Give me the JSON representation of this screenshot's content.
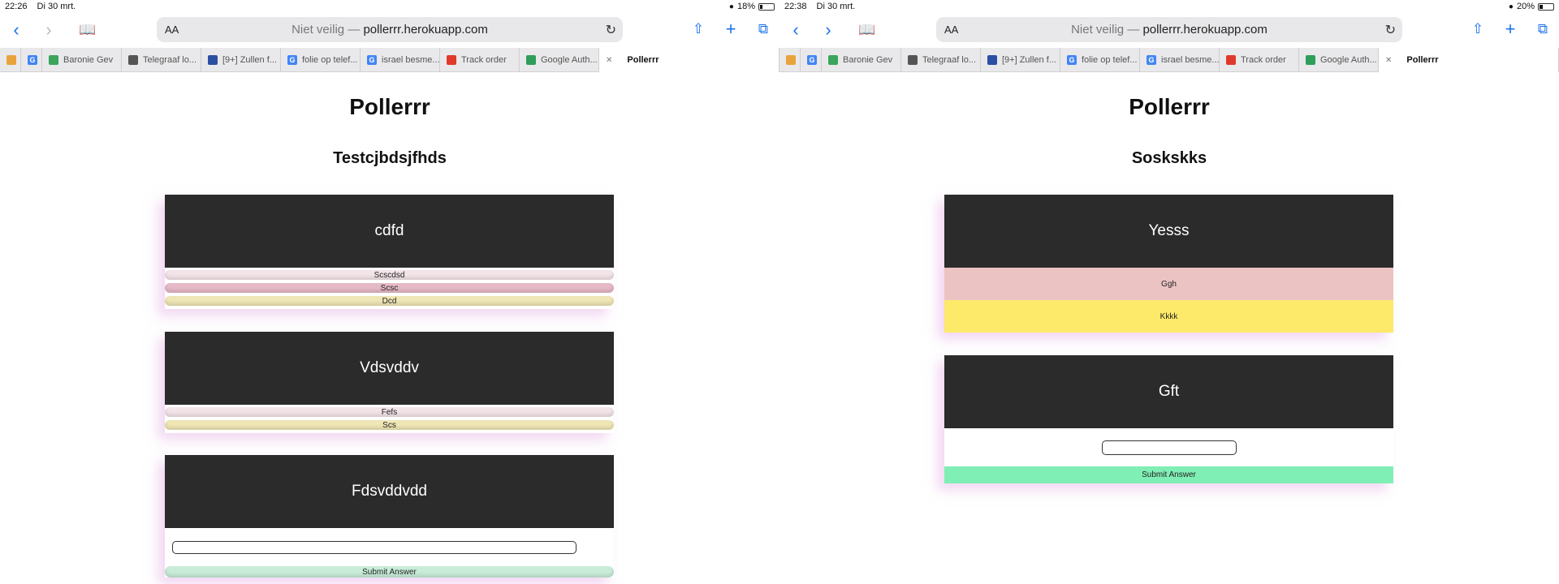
{
  "left": {
    "status": {
      "time": "22:26",
      "date": "Di 30 mrt.",
      "battery": "18%",
      "battery_level": 0.18
    },
    "url": {
      "aa": "AA",
      "insecure": "Niet veilig —",
      "host": "pollerrr.herokuapp.com"
    },
    "tabs": [
      {
        "label": "",
        "fav": "",
        "color": "#e8a33d"
      },
      {
        "label": "",
        "fav": "G",
        "color": "#4285f4"
      },
      {
        "label": "Baronie Gev",
        "fav": "",
        "color": "#3aa55b"
      },
      {
        "label": "Telegraaf lo...",
        "fav": "",
        "color": "#555555"
      },
      {
        "label": "[9+] Zullen f...",
        "fav": "",
        "color": "#2b4fa3"
      },
      {
        "label": "folie op telef...",
        "fav": "G",
        "color": "#4285f4"
      },
      {
        "label": "israel besme...",
        "fav": "G",
        "color": "#4285f4"
      },
      {
        "label": "Track order",
        "fav": "",
        "color": "#e0392b"
      },
      {
        "label": "Google Auth...",
        "fav": "",
        "color": "#2e9e5b"
      },
      {
        "label": "Pollerrr",
        "fav": "",
        "color": "#888888"
      }
    ],
    "site_title": "Pollerrr",
    "poll_title": "Testcjbdsjfhds",
    "questions": [
      {
        "title": "cdfd",
        "options": [
          {
            "label": "Scscdsd",
            "color": "#f3e4e8"
          },
          {
            "label": "Scsc",
            "color": "#e6b9c6"
          },
          {
            "label": "Dcd",
            "color": "#efe6b5"
          }
        ]
      },
      {
        "title": "Vdsvddv",
        "options": [
          {
            "label": "Fefs",
            "color": "#f3e4e8"
          },
          {
            "label": "Scs",
            "color": "#efe6b5"
          }
        ]
      },
      {
        "title": "Fdsvddvdd",
        "submit": "Submit Answer",
        "submit_color": "#c8ecd8"
      }
    ]
  },
  "right": {
    "status": {
      "time": "22:38",
      "date": "Di 30 mrt.",
      "battery": "20%",
      "battery_level": 0.2
    },
    "url": {
      "aa": "AA",
      "insecure": "Niet veilig —",
      "host": "pollerrr.herokuapp.com"
    },
    "tabs": [
      {
        "label": "",
        "fav": "",
        "color": "#e8a33d"
      },
      {
        "label": "",
        "fav": "G",
        "color": "#4285f4"
      },
      {
        "label": "Baronie Gev",
        "fav": "",
        "color": "#3aa55b"
      },
      {
        "label": "Telegraaf lo...",
        "fav": "",
        "color": "#555555"
      },
      {
        "label": "[9+] Zullen f...",
        "fav": "",
        "color": "#2b4fa3"
      },
      {
        "label": "folie op telef...",
        "fav": "G",
        "color": "#4285f4"
      },
      {
        "label": "israel besme...",
        "fav": "G",
        "color": "#4285f4"
      },
      {
        "label": "Track order",
        "fav": "",
        "color": "#e0392b"
      },
      {
        "label": "Google Auth...",
        "fav": "",
        "color": "#2e9e5b"
      },
      {
        "label": "Pollerrr",
        "fav": "",
        "color": "#888888"
      }
    ],
    "site_title": "Pollerrr",
    "poll_title": "Soskskks",
    "questions": [
      {
        "title": "Yesss",
        "options": [
          {
            "label": "Ggh",
            "color": "#ecc3c3"
          },
          {
            "label": "Kkkk",
            "color": "#fde96a"
          }
        ]
      },
      {
        "title": "Gft",
        "submit": "Submit Answer",
        "submit_color": "#80efb5"
      }
    ]
  }
}
